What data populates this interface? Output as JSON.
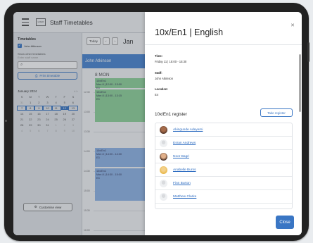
{
  "app": {
    "title": "Staff Timetables",
    "logo_text": "LOGO"
  },
  "sidebar": {
    "heading": "Timetables",
    "checked_staff": "John Atkinson",
    "other_label": "Show other timetables",
    "search_placeholder": "Enter staff name",
    "print_label": "Print timetable",
    "calendar": {
      "month_label": "January 2024",
      "weekdays": [
        "S",
        "M",
        "T",
        "W",
        "T",
        "F",
        "S"
      ],
      "weeks": [
        [
          "31",
          "1",
          "2",
          "3",
          "4",
          "5",
          "6"
        ],
        [
          "7",
          "8",
          "9",
          "10",
          "11",
          "12",
          "13"
        ],
        [
          "14",
          "15",
          "16",
          "17",
          "18",
          "19",
          "20"
        ],
        [
          "21",
          "22",
          "23",
          "24",
          "25",
          "26",
          "27"
        ],
        [
          "28",
          "29",
          "30",
          "31",
          "1",
          "2",
          "3"
        ],
        [
          "4",
          "5",
          "6",
          "7",
          "8",
          "9",
          "10"
        ]
      ],
      "selected_day": "12"
    },
    "customise_label": "Customise view"
  },
  "calendar": {
    "today_label": "Today",
    "month_label": "Jan",
    "staff_name": "John Atkinson",
    "day_label": "8 MON",
    "times": [
      "12:30",
      "13:00",
      "13:30",
      "14:00",
      "14:30",
      "15:00",
      "15:30",
      "16:00"
    ],
    "events": [
      {
        "title": "10x/En1",
        "time": "Mon 8 | 12:00 - 13:00",
        "room": "E3",
        "color": "green"
      },
      {
        "title": "10x/En1",
        "time": "Mon 8 | 13:00 - 13:15",
        "room": "E3",
        "color": "green"
      },
      {
        "title": "10x/En1",
        "time": "Mon 8 | 14:00 - 14:30",
        "room": "E3",
        "color": "blue"
      },
      {
        "title": "10x/En1",
        "time": "Mon 8 | 14:30 - 15:00",
        "room": "E3",
        "color": "blue"
      }
    ]
  },
  "panel": {
    "title": "10x/En1 | English",
    "time_label": "Time:",
    "time_value": "Friday 11 | 15:00 - 15:30",
    "staff_label": "Staff:",
    "staff_value": "John Atkinson",
    "location_label": "Location:",
    "location_value": "E4",
    "register_title": "10x/En1 register",
    "take_register_label": "Take register",
    "students": [
      {
        "name": "Akingunde Adeyemi",
        "avatar": "photo"
      },
      {
        "name": "Esran Andrews",
        "avatar": "placeholder"
      },
      {
        "name": "Noor Bagri",
        "avatar": "photo"
      },
      {
        "name": "Anabelle Burns",
        "avatar": "photo"
      },
      {
        "name": "Finn Burton",
        "avatar": "placeholder"
      },
      {
        "name": "Matthew Clarke",
        "avatar": "placeholder"
      }
    ],
    "close_label": "Close"
  },
  "colors": {
    "accent": "#3a76c4",
    "event_green": "#8fd39a",
    "event_blue": "#8fb4e6"
  }
}
